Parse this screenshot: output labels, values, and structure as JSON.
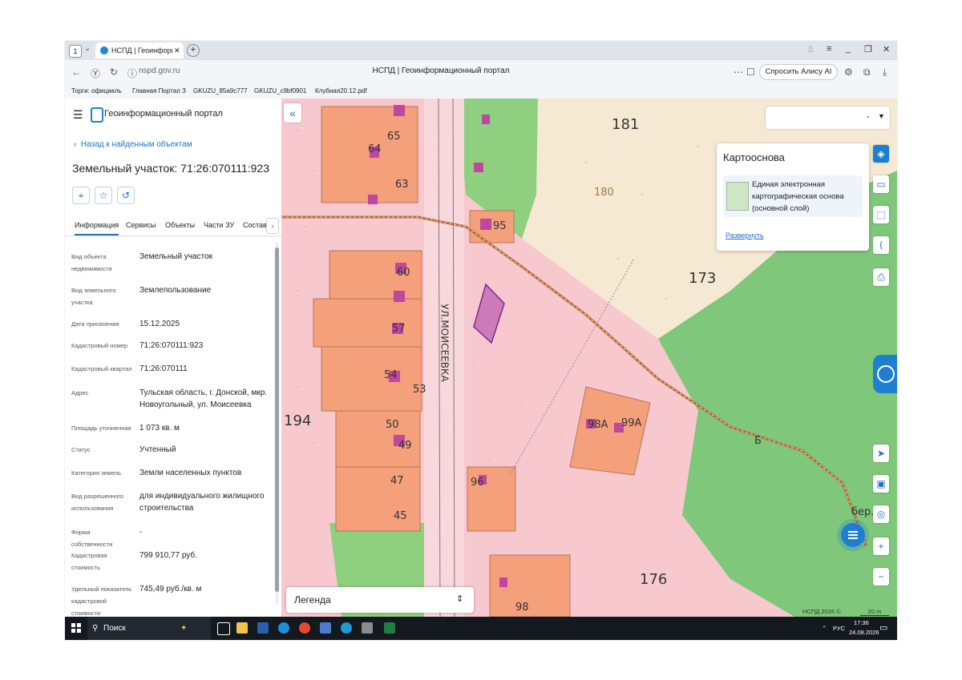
{
  "browser": {
    "tab_count": "1",
    "tab_title": "НСПД | Геоинформаці",
    "url": "nspd.gov.ru",
    "page_title": "НСПД | Геоинформационный портал",
    "alice_label": "Спросить Алису AI",
    "bookmarks": [
      "Торги: официаль",
      "Главная Портал З",
      "GKUZU_85a9c777",
      "GKUZU_c9bf0901",
      "Клубная20.12.pdf"
    ]
  },
  "panel": {
    "brand": "Геоинформационный портал",
    "back_label": "Назад к найденным объектам",
    "title": "Земельный участок: 71:26:070111:923",
    "tabs": [
      "Информация",
      "Сервисы",
      "Объекты",
      "Части ЗУ",
      "Состав"
    ],
    "rows": [
      {
        "key": "Вид объекта недвижимости",
        "value": "Земельный участок"
      },
      {
        "key": "Вид земельного участка",
        "value": "Землепользование"
      },
      {
        "key": "Дата присвоения",
        "value": "15.12.2025"
      },
      {
        "key": "Кадастровый номер",
        "value": "71:26:070111:923"
      },
      {
        "key": "Кадастровый квартал",
        "value": "71:26:070111"
      },
      {
        "key": "Адрес",
        "value": "Тульская область, г. Донской, мкр. Новоугольный, ул. Моисеевка"
      },
      {
        "key": "Площадь уточненная",
        "value": "1 073 кв. м"
      },
      {
        "key": "Статус",
        "value": "Учтенный"
      },
      {
        "key": "Категория земель",
        "value": "Земли населенных пунктов"
      },
      {
        "key": "Вид разрешенного использования",
        "value": "для индивидуального жилищного строительства"
      },
      {
        "key": "Форма собственности",
        "value": "-"
      },
      {
        "key": "Кадастровая стоимость",
        "value": "799 910,77 руб."
      },
      {
        "key": "Удельный показатель кадастровой стоимости",
        "value": "745,49 руб./кв. м"
      }
    ]
  },
  "map": {
    "layer_select_value": "-",
    "basemap_title": "Картооснова",
    "basemap_name": "Единая электронная картографическая основа (основной слой)",
    "basemap_expand": "Развернуть",
    "legend_label": "Легенда",
    "copyright": "НСПД 2026 ©",
    "scale": "20 m",
    "labels": {
      "n181": "181",
      "n173": "173",
      "n194": "194",
      "n176": "176",
      "n180": "180",
      "n64": "64",
      "n65": "65",
      "n63": "63",
      "n95": "95",
      "n60": "60",
      "n57": "57",
      "n54": "54",
      "n53": "53",
      "n50": "50",
      "n49": "49",
      "n47": "47",
      "n45": "45",
      "n96": "96",
      "n98": "98",
      "n98a": "98А",
      "n99a": "99А",
      "street": "УЛ.МОИСЕЕВКА",
      "b": "Б",
      "ber": "бер."
    },
    "colors": {
      "zone_pink": "#f7c9cf",
      "forest": "#7fc77a",
      "field": "#f5e9d3",
      "parcel": "#f4a07a",
      "building": "#c0479e"
    }
  },
  "taskbar": {
    "search_label": "Поиск",
    "lang": "РУС",
    "time": "17:36",
    "date": "24.08.2026"
  }
}
